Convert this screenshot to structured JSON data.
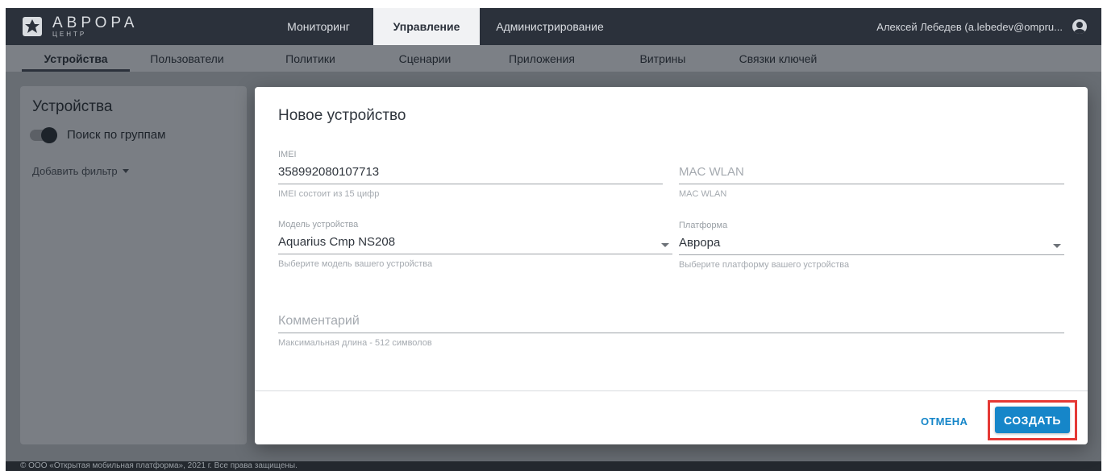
{
  "brand": {
    "name": "АВРОРА",
    "sub": "ЦЕНТР"
  },
  "main_nav": [
    {
      "label": "Мониторинг",
      "active": false
    },
    {
      "label": "Управление",
      "active": true
    },
    {
      "label": "Администрирование",
      "active": false
    }
  ],
  "user": {
    "display": "Алексей Лебедев (a.lebedev@ompru..."
  },
  "sub_nav": [
    {
      "label": "Устройства",
      "active": true
    },
    {
      "label": "Пользователи",
      "active": false
    },
    {
      "label": "Политики",
      "active": false
    },
    {
      "label": "Сценарии",
      "active": false
    },
    {
      "label": "Приложения",
      "active": false
    },
    {
      "label": "Витрины",
      "active": false
    },
    {
      "label": "Связки ключей",
      "active": false
    }
  ],
  "left_panel": {
    "title": "Устройства",
    "toggle_label": "Поиск по группам",
    "add_filter": "Добавить фильтр"
  },
  "dialog": {
    "title": "Новое устройство",
    "fields": {
      "imei": {
        "label": "IMEI",
        "value": "358992080107713",
        "hint": "IMEI состоит из 15 цифр"
      },
      "mac": {
        "placeholder": "MAC WLAN",
        "hint": "MAC WLAN"
      },
      "model": {
        "label": "Модель устройства",
        "value": "Aquarius Cmp NS208",
        "hint": "Выберите модель вашего устройства"
      },
      "platform": {
        "label": "Платформа",
        "value": "Аврора",
        "hint": "Выберите платформу вашего устройства"
      },
      "comment": {
        "placeholder": "Комментарий",
        "hint": "Максимальная длина - 512 символов"
      }
    },
    "cancel_label": "ОТМЕНА",
    "create_label": "СОЗДАТЬ"
  },
  "footer": {
    "text": "© ООО «Открытая мобильная платформа», 2021 г. Все права защищены."
  },
  "colors": {
    "topbar": "#2b313b",
    "accent": "#1686c9",
    "highlight": "#e53935"
  }
}
